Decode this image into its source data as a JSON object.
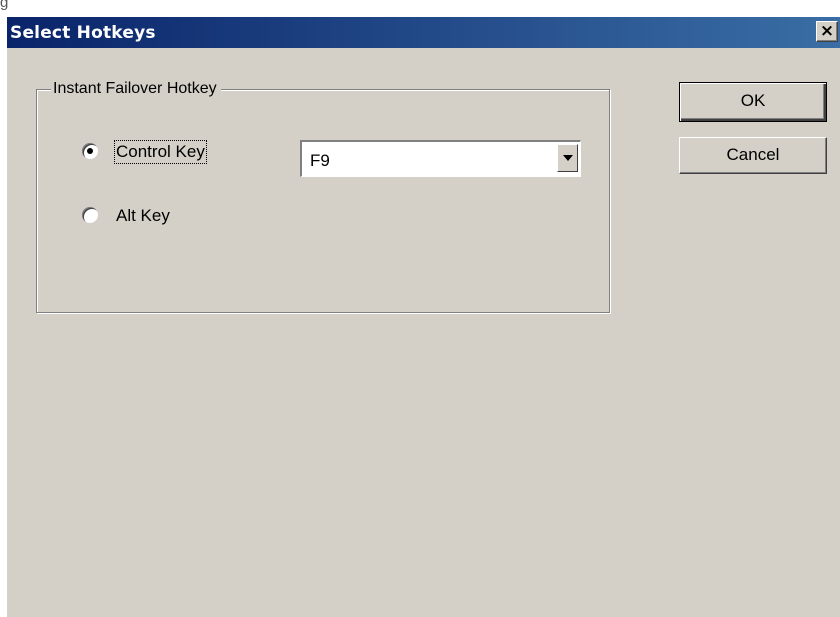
{
  "stray_text": "g",
  "dialog": {
    "title": "Select Hotkeys",
    "close_glyph": "×"
  },
  "groupbox": {
    "label": "Instant Failover Hotkey"
  },
  "radios": {
    "control": {
      "label": "Control Key",
      "checked": true
    },
    "alt": {
      "label": "Alt Key",
      "checked": false
    }
  },
  "combo": {
    "value": "F9",
    "arrow_icon": "chevron-down-icon"
  },
  "buttons": {
    "ok": "OK",
    "cancel": "Cancel"
  },
  "colors": {
    "face": "#d4d0c8",
    "title_start": "#0a246a",
    "title_end": "#3a6ea5"
  }
}
